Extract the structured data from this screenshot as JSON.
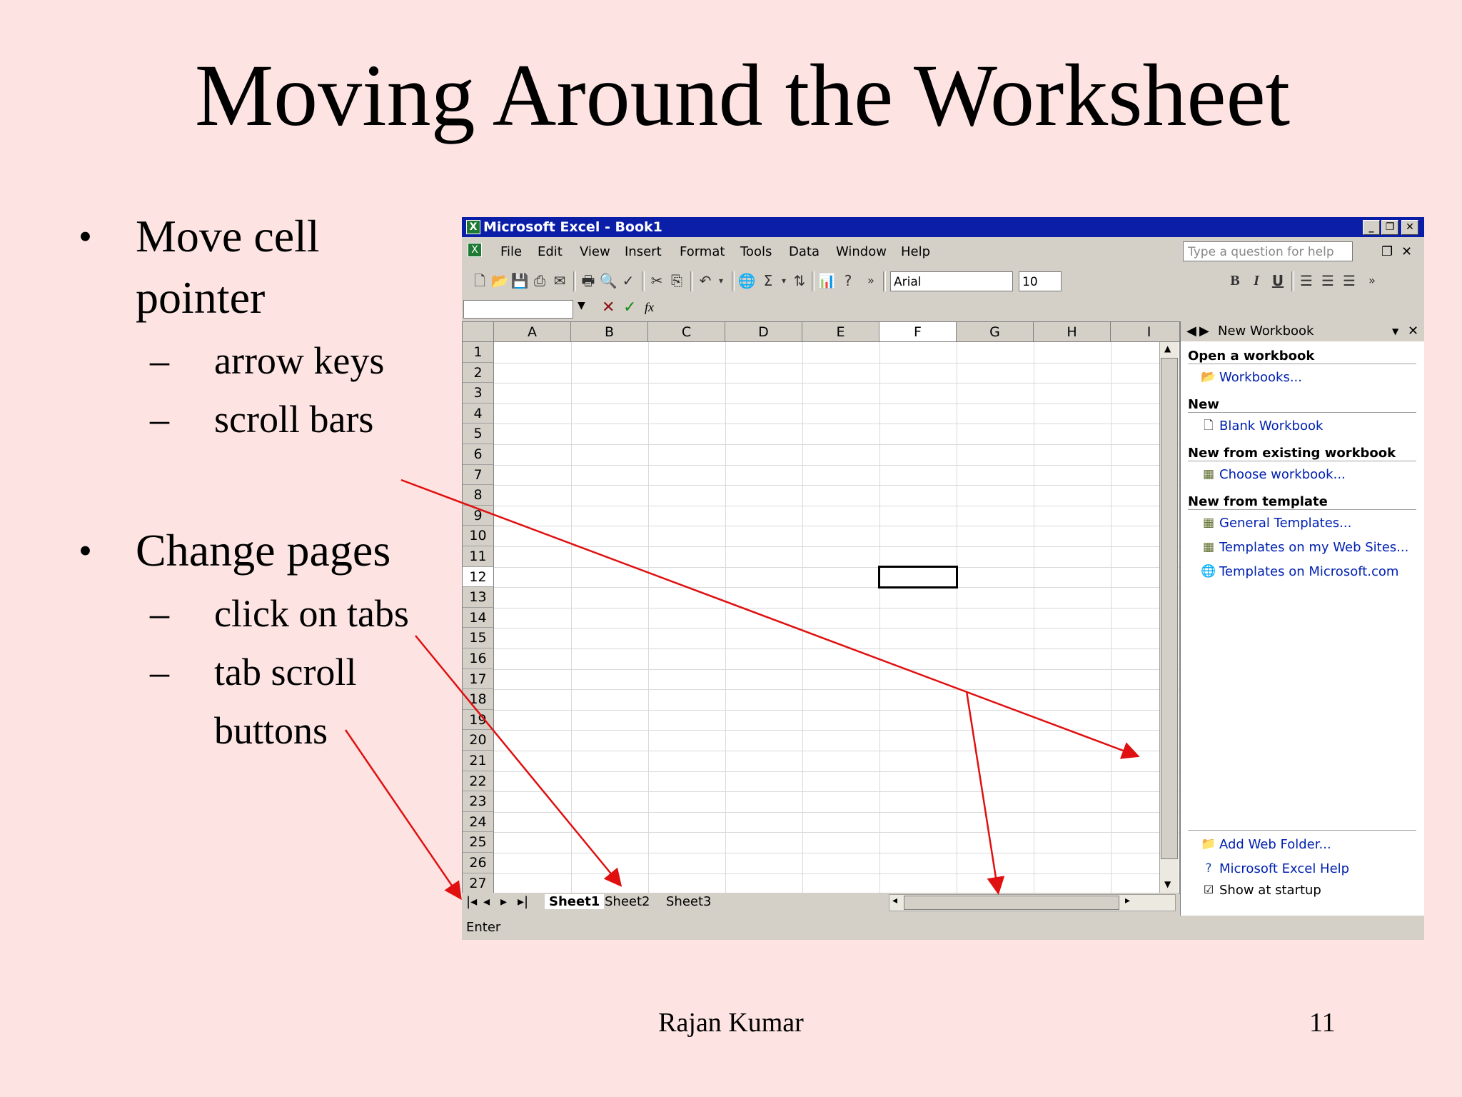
{
  "slide": {
    "title": "Moving Around the Worksheet",
    "bullets": [
      {
        "text_line1": "Move cell",
        "text_line2": "pointer",
        "sub": [
          "arrow keys",
          "scroll bars"
        ]
      },
      {
        "text_line1": "Change pages",
        "sub": [
          "click on tabs",
          "tab scroll",
          "buttons"
        ]
      }
    ],
    "bullet_glyph": "•",
    "dash_glyph": "–",
    "author": "Rajan Kumar",
    "page_number": "11"
  },
  "excel": {
    "window_title": "Microsoft Excel - Book1",
    "window_buttons": [
      "_",
      "❐",
      "✕"
    ],
    "menu": [
      "File",
      "Edit",
      "View",
      "Insert",
      "Format",
      "Tools",
      "Data",
      "Window",
      "Help"
    ],
    "help_placeholder": "Type a question for help",
    "font_name": "Arial",
    "font_size": "10",
    "format_buttons": [
      "B",
      "I",
      "U"
    ],
    "formula_icons": {
      "cancel": "✕",
      "enter": "✓",
      "function": "fx"
    },
    "columns": [
      "A",
      "B",
      "C",
      "D",
      "E",
      "F",
      "G",
      "H",
      "I"
    ],
    "rows": [
      "1",
      "2",
      "3",
      "4",
      "5",
      "6",
      "7",
      "8",
      "9",
      "10",
      "11",
      "12",
      "13",
      "14",
      "15",
      "16",
      "17",
      "18",
      "19",
      "20",
      "21",
      "22",
      "23",
      "24",
      "25",
      "26",
      "27"
    ],
    "active_cell": "F12",
    "sheet_tabs": [
      "Sheet1",
      "Sheet2",
      "Sheet3"
    ],
    "tab_nav_glyphs": [
      "|◂",
      "◂",
      "▸",
      "▸|"
    ],
    "status": "Enter",
    "task_pane": {
      "title": "New Workbook",
      "sections": [
        {
          "heading": "Open a workbook",
          "links": [
            "Workbooks..."
          ]
        },
        {
          "heading": "New",
          "links": [
            "Blank Workbook"
          ]
        },
        {
          "heading": "New from existing workbook",
          "links": [
            "Choose workbook..."
          ]
        },
        {
          "heading": "New from template",
          "links": [
            "General Templates...",
            "Templates on my Web Sites...",
            "Templates on Microsoft.com"
          ]
        }
      ],
      "footer_links": [
        "Add Web Folder...",
        "Microsoft Excel Help"
      ],
      "show_at_startup": "Show at startup"
    }
  },
  "colors": {
    "background": "#fde4e2",
    "arrow": "#e01010",
    "titlebar": "#0a1ea8"
  }
}
